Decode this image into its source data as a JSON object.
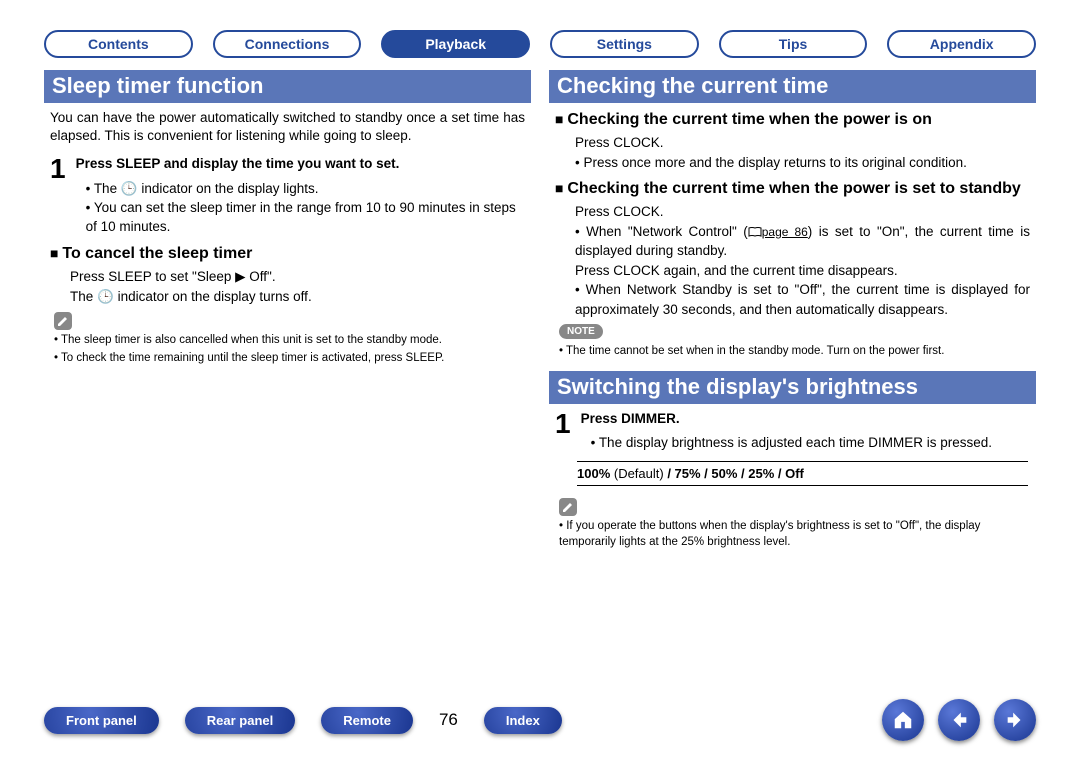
{
  "tabs": {
    "items": [
      "Contents",
      "Connections",
      "Playback",
      "Settings",
      "Tips",
      "Appendix"
    ],
    "active_index": 2
  },
  "left": {
    "title": "Sleep timer function",
    "intro": "You can have the power automatically switched to standby once a set time has elapsed. This is convenient for listening while going to sleep.",
    "step1_head": "Press SLEEP and display the time you want to set.",
    "step1_b1": "The 🕒 indicator on the display lights.",
    "step1_b2": "You can set the sleep timer in the range from 10 to 90 minutes in steps of 10 minutes.",
    "cancel_head": "To cancel the sleep timer",
    "cancel_l1a": "Press SLEEP to set \"Sleep ",
    "cancel_l1b": " Off\".",
    "cancel_l2": "The 🕒 indicator on the display turns off.",
    "note1": "The sleep timer is also cancelled when this unit is set to the standby mode.",
    "note2": "To check the time remaining until the sleep timer is activated, press SLEEP."
  },
  "right": {
    "title1": "Checking the current time",
    "h1": "Checking the current time when the power is on",
    "h1_l1": "Press CLOCK.",
    "h1_l2": "Press once more and the display returns to its original condition.",
    "h2": "Checking the current time when the power is set to standby",
    "h2_l1": "Press CLOCK.",
    "h2_l2a": "When \"Network Control\" (",
    "h2_l2_link": "page 86",
    "h2_l2b": ") is set to \"On\", the current time is displayed during standby.",
    "h2_l3": "Press CLOCK again, and the current time disappears.",
    "h2_l4": "When Network Standby is set to \"Off\", the current time is displayed for approximately 30 seconds, and then automatically disappears.",
    "note_label": "NOTE",
    "note_text": "The time cannot be set when in the standby mode. Turn on the power first.",
    "title2": "Switching the display's brightness",
    "dim_head": "Press DIMMER.",
    "dim_b1": "The display brightness is adjusted each time DIMMER is pressed.",
    "levels_prefix": "100%",
    "levels_default": " (Default) ",
    "levels_rest": "/ 75% / 50% / 25% / Off",
    "dim_note": "If you operate the buttons when the display's brightness is set to \"Off\", the display temporarily lights at the 25% brightness level."
  },
  "bottom": {
    "buttons": [
      "Front panel",
      "Rear panel",
      "Remote",
      "Index"
    ],
    "page": "76"
  }
}
